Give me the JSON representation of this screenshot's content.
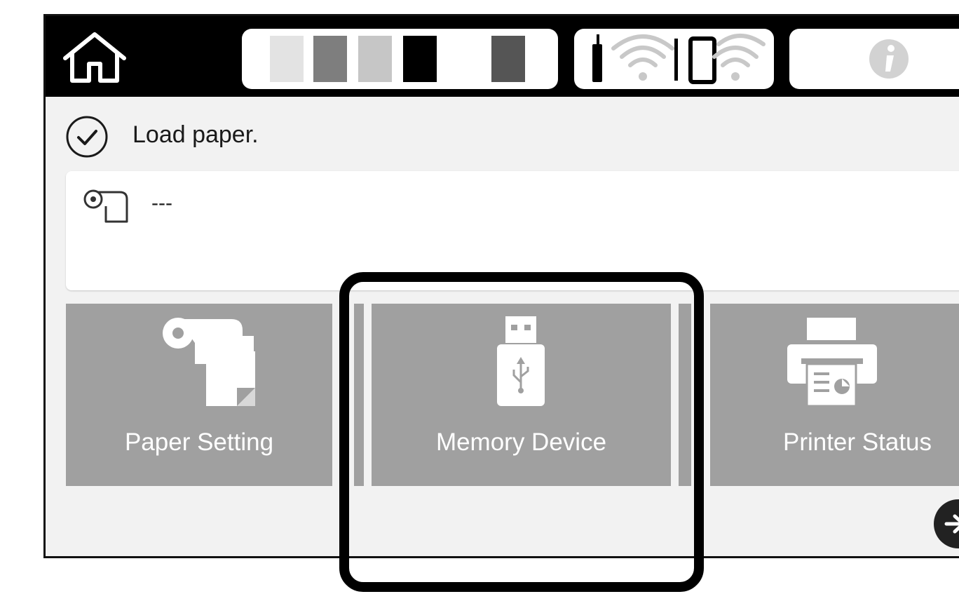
{
  "status": {
    "message": "Load paper.",
    "icon": "check-circle-icon"
  },
  "paper_source": {
    "icon": "roll-paper-icon",
    "info": "---"
  },
  "header": {
    "home_icon": "home-icon",
    "ink_levels": {
      "icon": "ink-cartridges-icon",
      "cartridge_colors": [
        "#e3e3e3",
        "#7e7e7e",
        "#c6c6c6",
        "#000000",
        "#ffffff",
        "#555555"
      ]
    },
    "network": {
      "wifi_icon": "wifi-icon",
      "wifi_direct_icon": "wifi-direct-icon"
    },
    "info_icon": "info-icon"
  },
  "menu": {
    "tiles": [
      {
        "label": "Paper Setting",
        "icon": "paper-setting-icon"
      },
      {
        "label": "Memory Device",
        "icon": "usb-memory-icon"
      },
      {
        "label": "Printer Status",
        "icon": "printer-icon"
      }
    ]
  },
  "highlight": {
    "target": "Memory Device"
  },
  "colors": {
    "tile_bg": "#a0a0a0",
    "screen_bg": "#f2f2f2",
    "header_bg": "#000000",
    "text": "#1a1a1a"
  }
}
